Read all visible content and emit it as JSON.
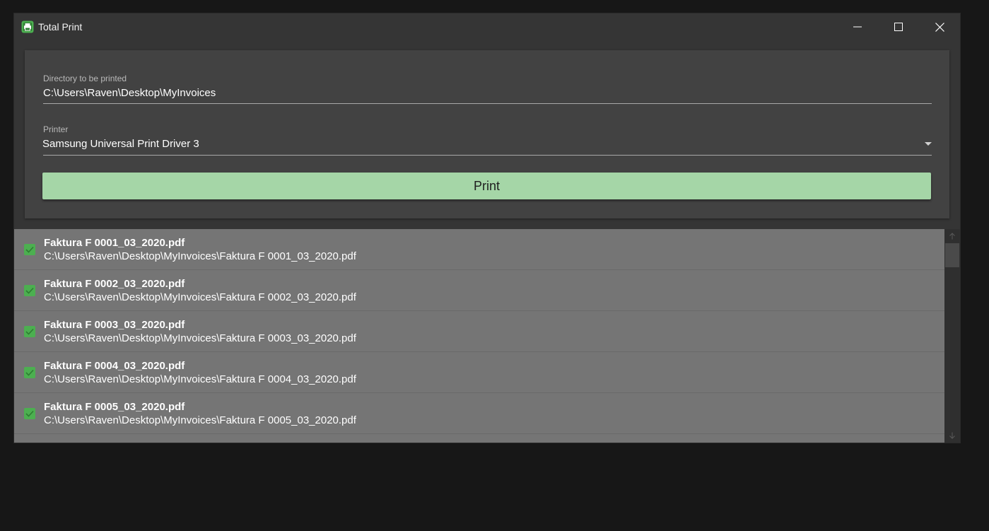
{
  "window": {
    "title": "Total Print"
  },
  "form": {
    "directory_label": "Directory to be printed",
    "directory_value": "C:\\Users\\Raven\\Desktop\\MyInvoices",
    "printer_label": "Printer",
    "printer_value": "Samsung Universal Print Driver 3",
    "print_button_label": "Print"
  },
  "files": [
    {
      "name": "Faktura F 0001_03_2020.pdf",
      "path": "C:\\Users\\Raven\\Desktop\\MyInvoices\\Faktura F 0001_03_2020.pdf",
      "checked": true
    },
    {
      "name": "Faktura F 0002_03_2020.pdf",
      "path": "C:\\Users\\Raven\\Desktop\\MyInvoices\\Faktura F 0002_03_2020.pdf",
      "checked": true
    },
    {
      "name": "Faktura F 0003_03_2020.pdf",
      "path": "C:\\Users\\Raven\\Desktop\\MyInvoices\\Faktura F 0003_03_2020.pdf",
      "checked": true
    },
    {
      "name": "Faktura F 0004_03_2020.pdf",
      "path": "C:\\Users\\Raven\\Desktop\\MyInvoices\\Faktura F 0004_03_2020.pdf",
      "checked": true
    },
    {
      "name": "Faktura F 0005_03_2020.pdf",
      "path": "C:\\Users\\Raven\\Desktop\\MyInvoices\\Faktura F 0005_03_2020.pdf",
      "checked": true
    }
  ],
  "icons": {
    "app": "printer-icon",
    "minimize": "minimize-icon",
    "maximize": "maximize-icon",
    "close": "close-icon",
    "dropdown": "dropdown-arrow-icon",
    "checkbox": "checkmark-icon",
    "scroll_up": "arrow-up-icon",
    "scroll_down": "arrow-down-icon"
  },
  "colors": {
    "accent_green": "#4caf50",
    "button_green": "#a5d6a7",
    "window_bg": "#353535",
    "card_bg": "#424242",
    "list_bg": "#757575",
    "desktop_bg": "#171717"
  }
}
